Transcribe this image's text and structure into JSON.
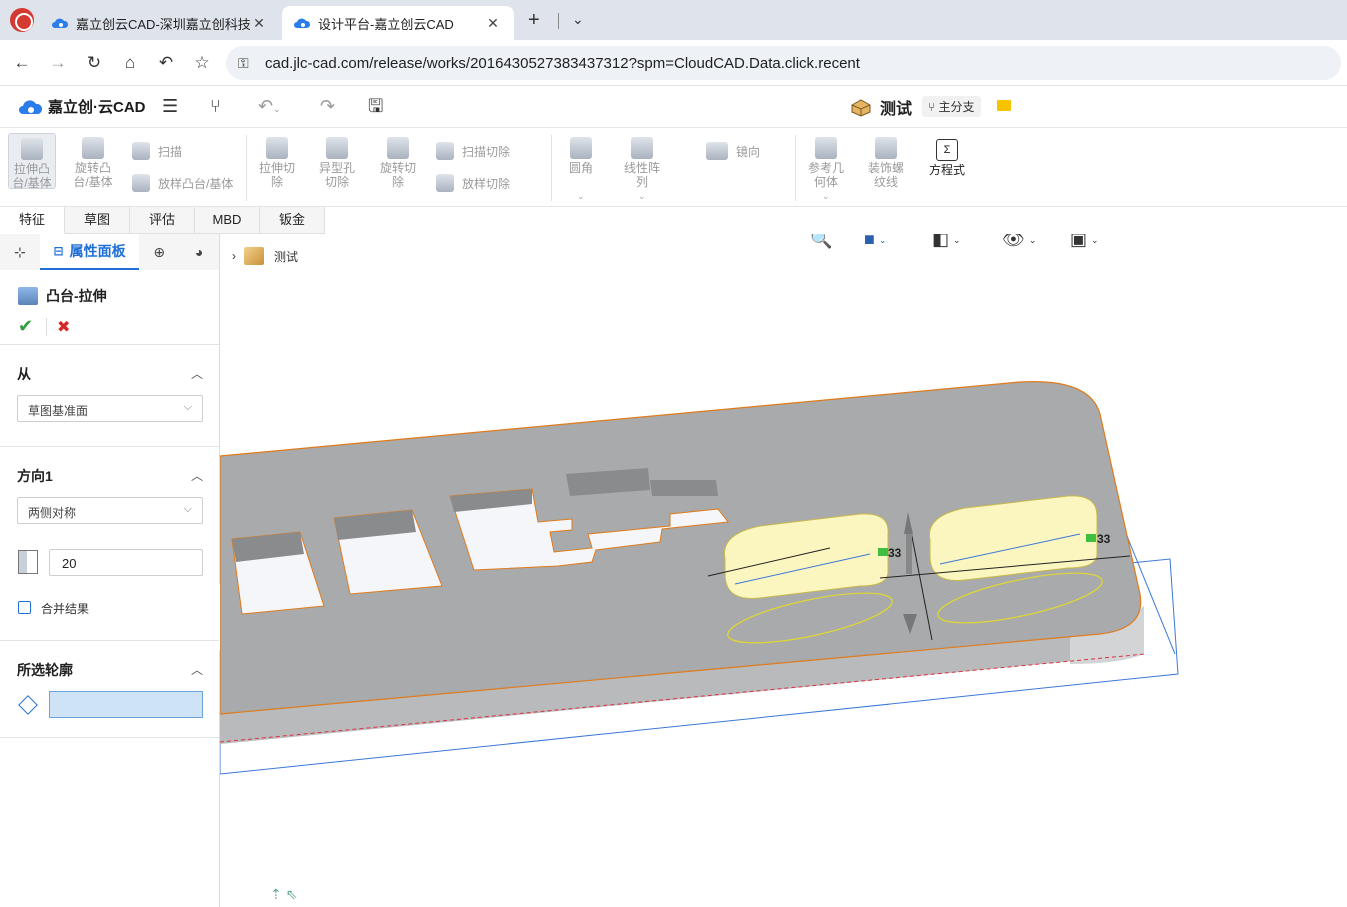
{
  "browser": {
    "tabs": [
      {
        "title": "嘉立创云CAD-深圳嘉立创科技",
        "active": false
      },
      {
        "title": "设计平台-嘉立创云CAD",
        "active": true
      }
    ],
    "new_tab_label": "+",
    "url": "cad.jlc-cad.com/release/works/201643052738343731​2?spm=CloudCAD.Data.click.recent"
  },
  "app": {
    "logo_text": "嘉立创·云CAD",
    "document_title": "测试",
    "branch": "主分支"
  },
  "ribbon": {
    "groups": [
      {
        "label": "拉伸凸台/基体",
        "lines": [
          "拉伸凸",
          "台/基体"
        ]
      },
      {
        "label": "旋转凸台/基体",
        "lines": [
          "旋转凸",
          "台/基体"
        ]
      },
      {
        "label": "扫描"
      },
      {
        "label": "放样凸台/基体"
      },
      {
        "label": "拉伸切除",
        "lines": [
          "拉伸切",
          "除"
        ]
      },
      {
        "label": "异型孔切除",
        "lines": [
          "异型孔",
          "切除"
        ]
      },
      {
        "label": "旋转切除",
        "lines": [
          "旋转切",
          "除"
        ]
      },
      {
        "label": "扫描切除"
      },
      {
        "label": "放样切除"
      },
      {
        "label": "圆角"
      },
      {
        "label": "线性阵列",
        "lines": [
          "线性阵",
          "列"
        ]
      },
      {
        "label": "镜向"
      },
      {
        "label": "参考几何体",
        "lines": [
          "参考几",
          "何体"
        ]
      },
      {
        "label": "装饰螺纹线",
        "lines": [
          "装饰螺",
          "纹线"
        ]
      },
      {
        "label": "方程式"
      }
    ],
    "tabs": [
      "特征",
      "草图",
      "评估",
      "MBD",
      "钣金"
    ],
    "active_tab": "特征"
  },
  "panel": {
    "active_tab": "属性面板",
    "feature_title": "凸台-拉伸",
    "sections": {
      "from": {
        "header": "从",
        "value": "草图基准面"
      },
      "direction1": {
        "header": "方向1",
        "value": "两侧对称",
        "depth": "20",
        "merge_label": "合并结果",
        "merge_checked": false
      },
      "contours": {
        "header": "所选轮廓"
      }
    }
  },
  "viewport": {
    "breadcrumb": "测试",
    "dimension_labels": [
      "33",
      "33"
    ]
  },
  "colors": {
    "accent": "#1f6fd6",
    "ok": "#2e9e3e",
    "cancel": "#d62828",
    "model_top": "#a9aaab",
    "edge": "#e07b1a",
    "highlight": "#fbf5c0"
  }
}
